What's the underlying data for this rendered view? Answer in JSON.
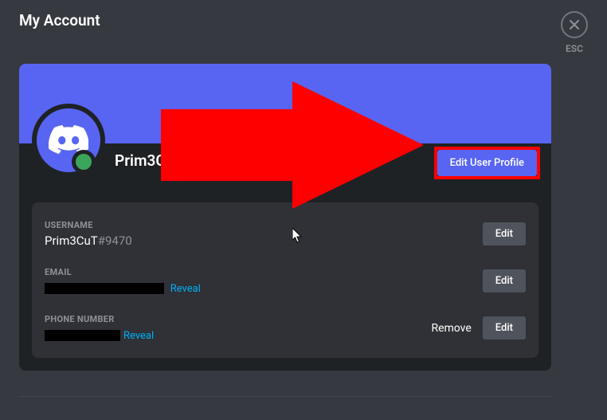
{
  "page": {
    "title": "My Account",
    "esc_label": "ESC"
  },
  "profile": {
    "display_name": "Prim3CuT",
    "edit_profile_label": "Edit User Profile"
  },
  "fields": {
    "username": {
      "label": "USERNAME",
      "name": "Prim3CuT",
      "discriminator": "#9470",
      "edit_label": "Edit"
    },
    "email": {
      "label": "EMAIL",
      "reveal_label": "Reveal",
      "edit_label": "Edit"
    },
    "phone": {
      "label": "PHONE NUMBER",
      "reveal_label": "Reveal",
      "remove_label": "Remove",
      "edit_label": "Edit"
    }
  }
}
